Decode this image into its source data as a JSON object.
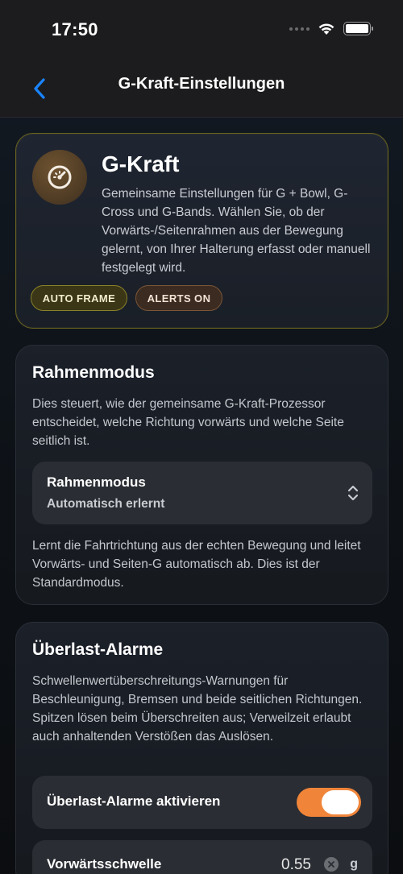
{
  "status_bar": {
    "time": "17:50"
  },
  "nav": {
    "title": "G-Kraft-Einstellungen",
    "back_icon": "chevron-left-icon"
  },
  "hero": {
    "title": "G-Kraft",
    "description": "Gemeinsame Einstellungen für G + Bowl, G-Cross und G-Bands. Wählen Sie, ob der Vorwärts-/Seitenrahmen aus der Bewegung gelernt, von Ihrer Halterung erfasst oder manuell festgelegt wird.",
    "icon": "gauge-icon",
    "chips": [
      {
        "label": "AUTO FRAME"
      },
      {
        "label": "ALERTS ON"
      }
    ]
  },
  "frame_section": {
    "title": "Rahmenmodus",
    "description": "Dies steuert, wie der gemeinsame G-Kraft-Prozessor entscheidet, welche Richtung vorwärts und welche Seite seitlich ist.",
    "picker": {
      "label": "Rahmenmodus",
      "value": "Automatisch erlernt"
    },
    "footnote": "Lernt die Fahrtrichtung aus der echten Bewegung und leitet Vorwärts- und Seiten-G automatisch ab. Dies ist der Standardmodus."
  },
  "alarm_section": {
    "title": "Überlast-Alarme",
    "description": "Schwellenwertüberschreitungs-Warnungen für Beschleunigung, Bremsen und beide seitlichen Richtungen. Spitzen lösen beim Überschreiten aus; Verweilzeit erlaubt auch anhaltenden Verstößen das Auslösen.",
    "toggle": {
      "label": "Überlast-Alarme aktivieren",
      "on": true
    },
    "threshold": {
      "label": "Vorwärtsschwelle",
      "value": "0.55",
      "unit": "g"
    }
  },
  "colors": {
    "accent_blue": "#1a84ff",
    "toggle_orange": "#f0853a",
    "chip_auto_border": "#8a8228",
    "chip_alerts_border": "#7a5538",
    "hero_border": "#6b6420"
  }
}
